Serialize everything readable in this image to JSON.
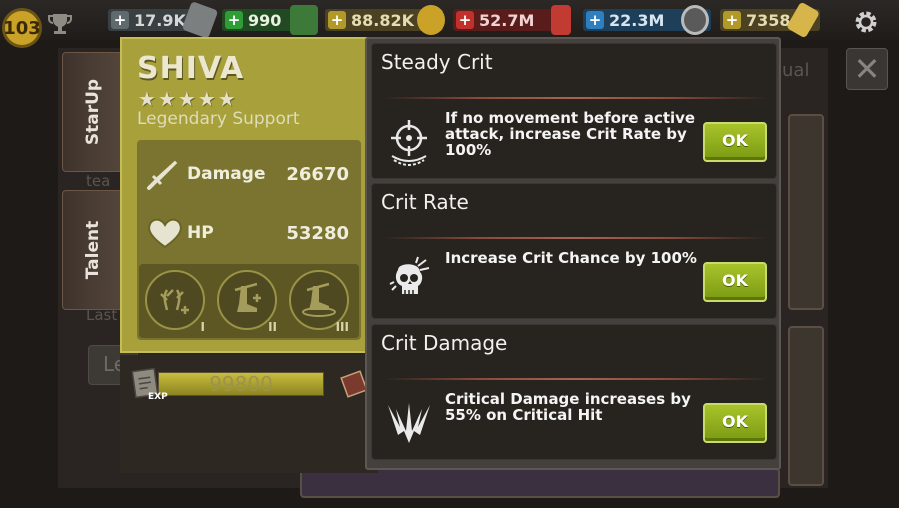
{
  "topbar": {
    "level": "103",
    "resources": [
      {
        "value": "17.9K",
        "plus": "+",
        "icon": "badge-icon"
      },
      {
        "value": "990",
        "plus": "+",
        "icon": "cash-icon"
      },
      {
        "value": "88.82K",
        "plus": "+",
        "icon": "coin-icon"
      },
      {
        "value": "52.7M",
        "plus": "+",
        "icon": "soda-can-icon"
      },
      {
        "value": "22.3M",
        "plus": "+",
        "icon": "wheel-icon"
      },
      {
        "value": "7358",
        "plus": "+",
        "icon": "ticket-icon"
      }
    ]
  },
  "side_tabs": {
    "starup": "StarUp",
    "talent": "Talent"
  },
  "background": {
    "frag_team": "tea",
    "frag_last": "Last",
    "frag_le": "Le",
    "frag_ual": "ual",
    "close": "✕"
  },
  "hero": {
    "name": "SHIVA",
    "stars": 5,
    "class": "Legendary Support",
    "damage_label": "Damage",
    "damage_value": "26670",
    "hp_label": "HP",
    "hp_value": "53280",
    "skills": [
      "I",
      "II",
      "III"
    ]
  },
  "exp": {
    "label": "EXP",
    "value": "99800",
    "fill_fraction": 1.0
  },
  "talents": [
    {
      "title": "Steady Crit",
      "description": "If no movement before active attack, increase Crit Rate by 100%",
      "ok_label": "OK",
      "icon": "crosshair-icon"
    },
    {
      "title": "Crit Rate",
      "description": "Increase Crit Chance by 100%",
      "ok_label": "OK",
      "icon": "skull-icon"
    },
    {
      "title": "Crit Damage",
      "description": "Critical Damage increases by 55% on Critical Hit",
      "ok_label": "OK",
      "icon": "claw-burst-icon"
    }
  ],
  "colors": {
    "hero_card": "#a8a03b",
    "ok_button": "#9bb81f",
    "popup_bg": "#27231f"
  }
}
